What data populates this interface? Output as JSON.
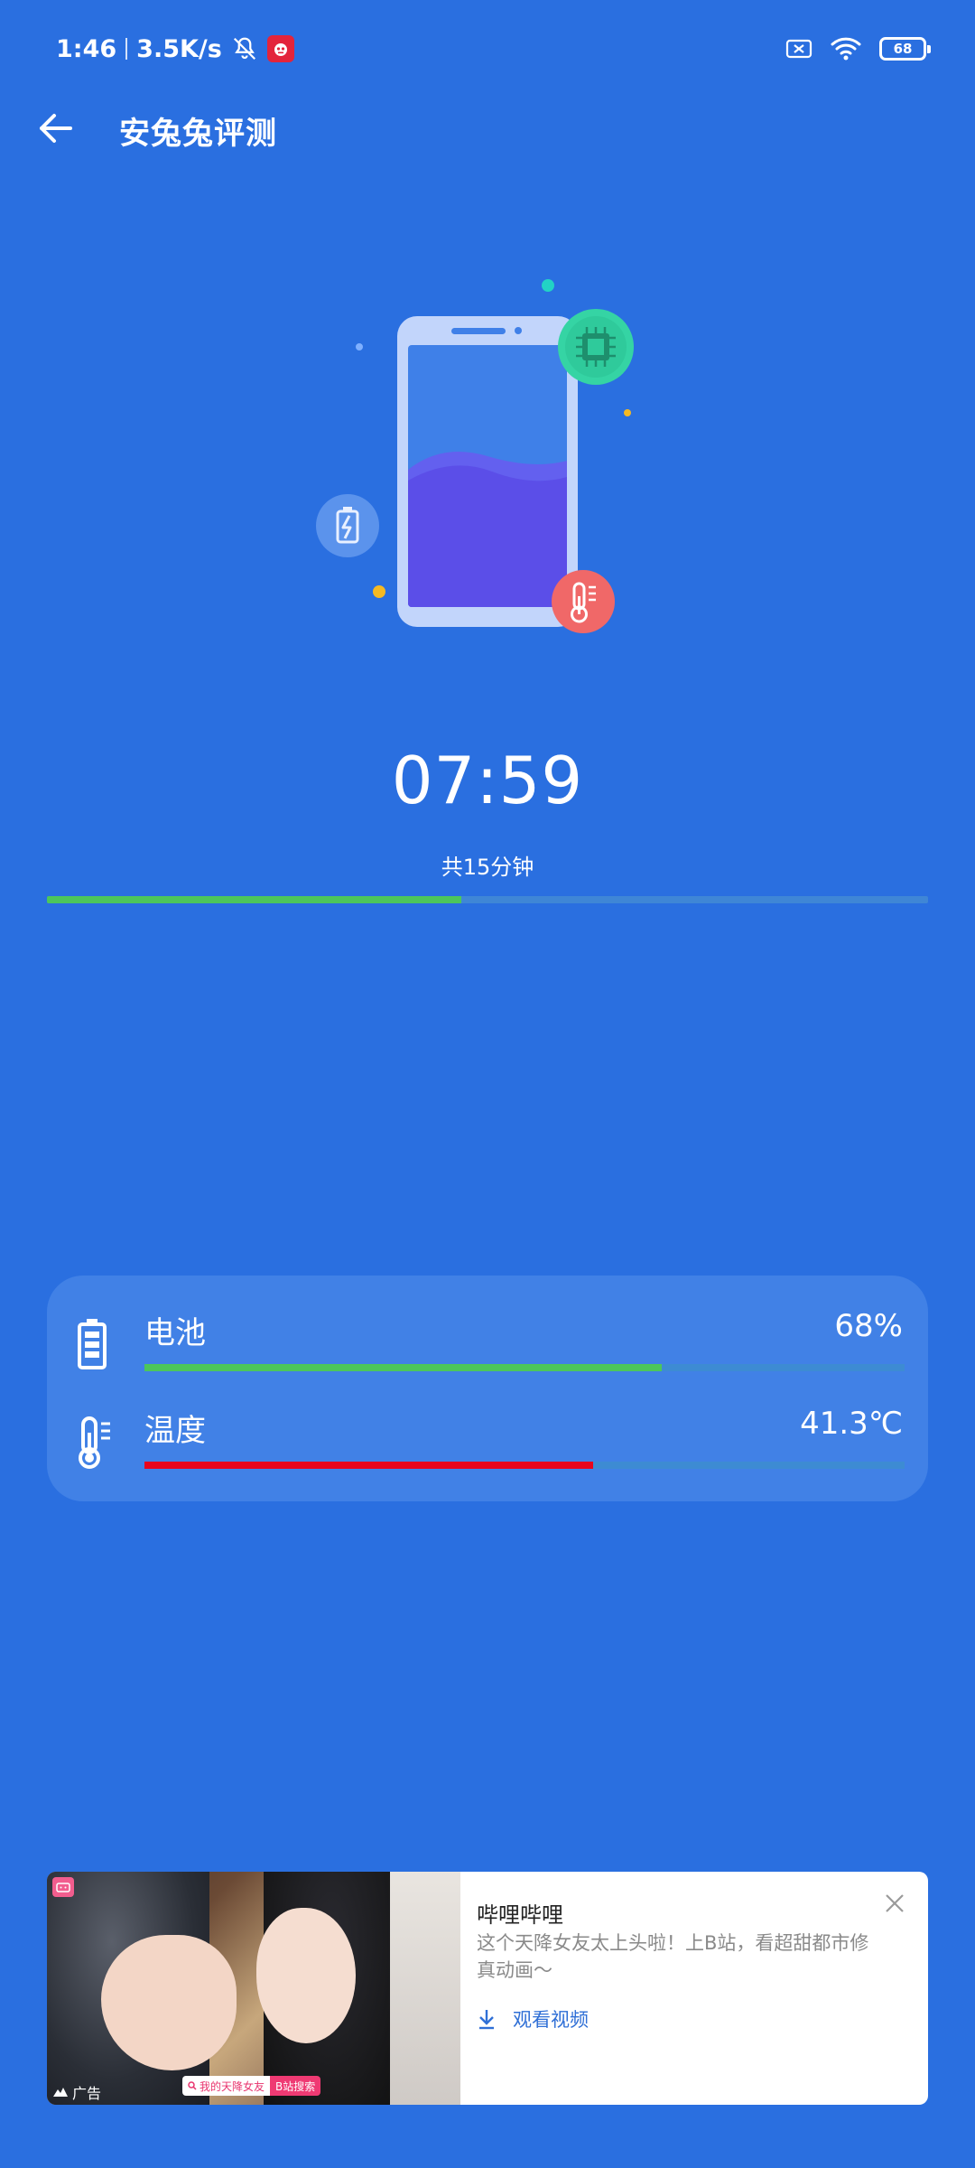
{
  "status_bar": {
    "time": "1:46",
    "net_speed": "3.5K/s",
    "battery_level": "68",
    "icons": [
      "bell-off-icon",
      "app-notification-icon",
      "sim-error-icon",
      "wifi-icon",
      "battery-icon"
    ]
  },
  "header": {
    "title": "安兔兔评测",
    "back_icon": "arrow-left-icon"
  },
  "illustration": {
    "icons": [
      "phone-icon",
      "chip-icon",
      "battery-charge-icon",
      "thermometer-icon"
    ]
  },
  "test": {
    "elapsed": "07:59",
    "total_label": "共15分钟",
    "progress_fraction": 0.47
  },
  "metrics": {
    "battery": {
      "label": "电池",
      "value": "68%",
      "fraction": 0.68,
      "color": "#4cc65b"
    },
    "temperature": {
      "label": "温度",
      "value": "41.3℃",
      "fraction": 0.59,
      "color": "#e8051e"
    }
  },
  "ad": {
    "advertiser": "哔哩哔哩",
    "description": "这个天降女友太上头啦！上B站，看超甜都市修真动画～",
    "cta": "观看视频",
    "ad_label": "广告",
    "image_search_query": "我的天降女友",
    "image_search_button": "B站搜索"
  }
}
